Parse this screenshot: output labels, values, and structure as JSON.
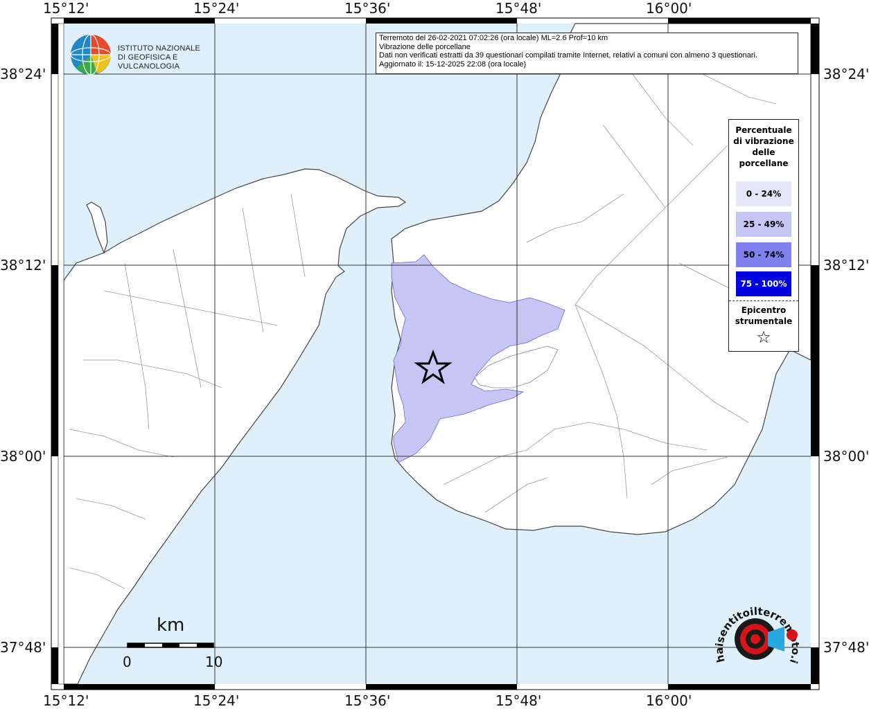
{
  "map": {
    "title_lines": [
      "Terremoto del 26-02-2021 07:02:26 (ora locale) ML=2.6 Prof=10 km",
      "Vibrazione delle porcellane",
      "Dati non verificati estratti da 39 questionari compilati tramite Internet, relativi a comuni con almeno 3 questionari.",
      "Aggiornato il: 15-12-2025 22:08 (ora locale)"
    ],
    "lon_ticks": [
      "15°12'",
      "15°24'",
      "15°36'",
      "15°48'",
      "16°00'"
    ],
    "lat_ticks": [
      "38°24'",
      "38°12'",
      "38°00'",
      "37°48'"
    ],
    "colors": {
      "sea": "#dff0fb",
      "land": "#ffffff",
      "affected_area": "#c6c6f5",
      "grid": "#333333",
      "rivers": "#9a9a9a"
    }
  },
  "legend": {
    "title": "Percentuale di vibrazione delle porcellane",
    "title_lines": [
      "Percentuale",
      "di vibrazione",
      "delle",
      "porcellane"
    ],
    "items": [
      {
        "label": "0 - 24%",
        "color": "#e6e6fa",
        "text_color": "#000000"
      },
      {
        "label": "25 - 49%",
        "color": "#c6c6f5",
        "text_color": "#000000"
      },
      {
        "label": "50 - 74%",
        "color": "#8080ee",
        "text_color": "#000000"
      },
      {
        "label": "75 - 100%",
        "color": "#0000e0",
        "text_color": "#ffffff"
      }
    ],
    "epicenter_lines": [
      "Epicentro",
      "strumentale"
    ],
    "epicenter_symbol": "☆"
  },
  "scale_bar": {
    "unit": "km",
    "start": "0",
    "end": "10"
  },
  "ingv_logo": {
    "lines": [
      "ISTITUTO NAZIONALE",
      "DI GEOFISICA E VULCANOLOGIA"
    ]
  },
  "hst_logo": {
    "text": "haisentitoilterremoto.it",
    "icon": "earthquake-target-icon"
  },
  "epicenter": {
    "icon": "star-icon"
  }
}
